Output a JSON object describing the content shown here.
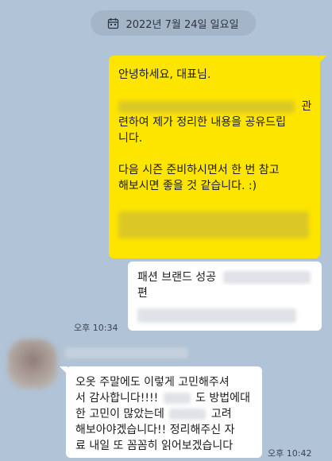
{
  "date_divider": "2022년 7월 24일 일요일",
  "yellow_message": {
    "line1": "안녕하세요, 대표님.",
    "line2_suffix": "관",
    "line3": "련하여 제가 정리한 내용을 공유드립",
    "line4": "니다.",
    "line5": "다음 시즌 준비하시면서 한 번 참고",
    "line6": "해보시면 좋을 것 같습니다. :)"
  },
  "link_message": {
    "line1": "패션 브랜드 성공",
    "line2": "편"
  },
  "time_sent": "오후 10:34",
  "reply_message": {
    "line1": "오옷 주말에도 이렇게 고민해주셔",
    "line2_a": "서 감사합니다!!!!",
    "line2_b": "도 방법에대",
    "line3_a": "한 고민이 많았는데",
    "line3_b": "고려",
    "line4": "해보아야겠습니다!! 정리해주신 자",
    "line5": "료 내일 또 꼼꼼히 읽어보겠습니다"
  },
  "time_received": "오후 10:42"
}
